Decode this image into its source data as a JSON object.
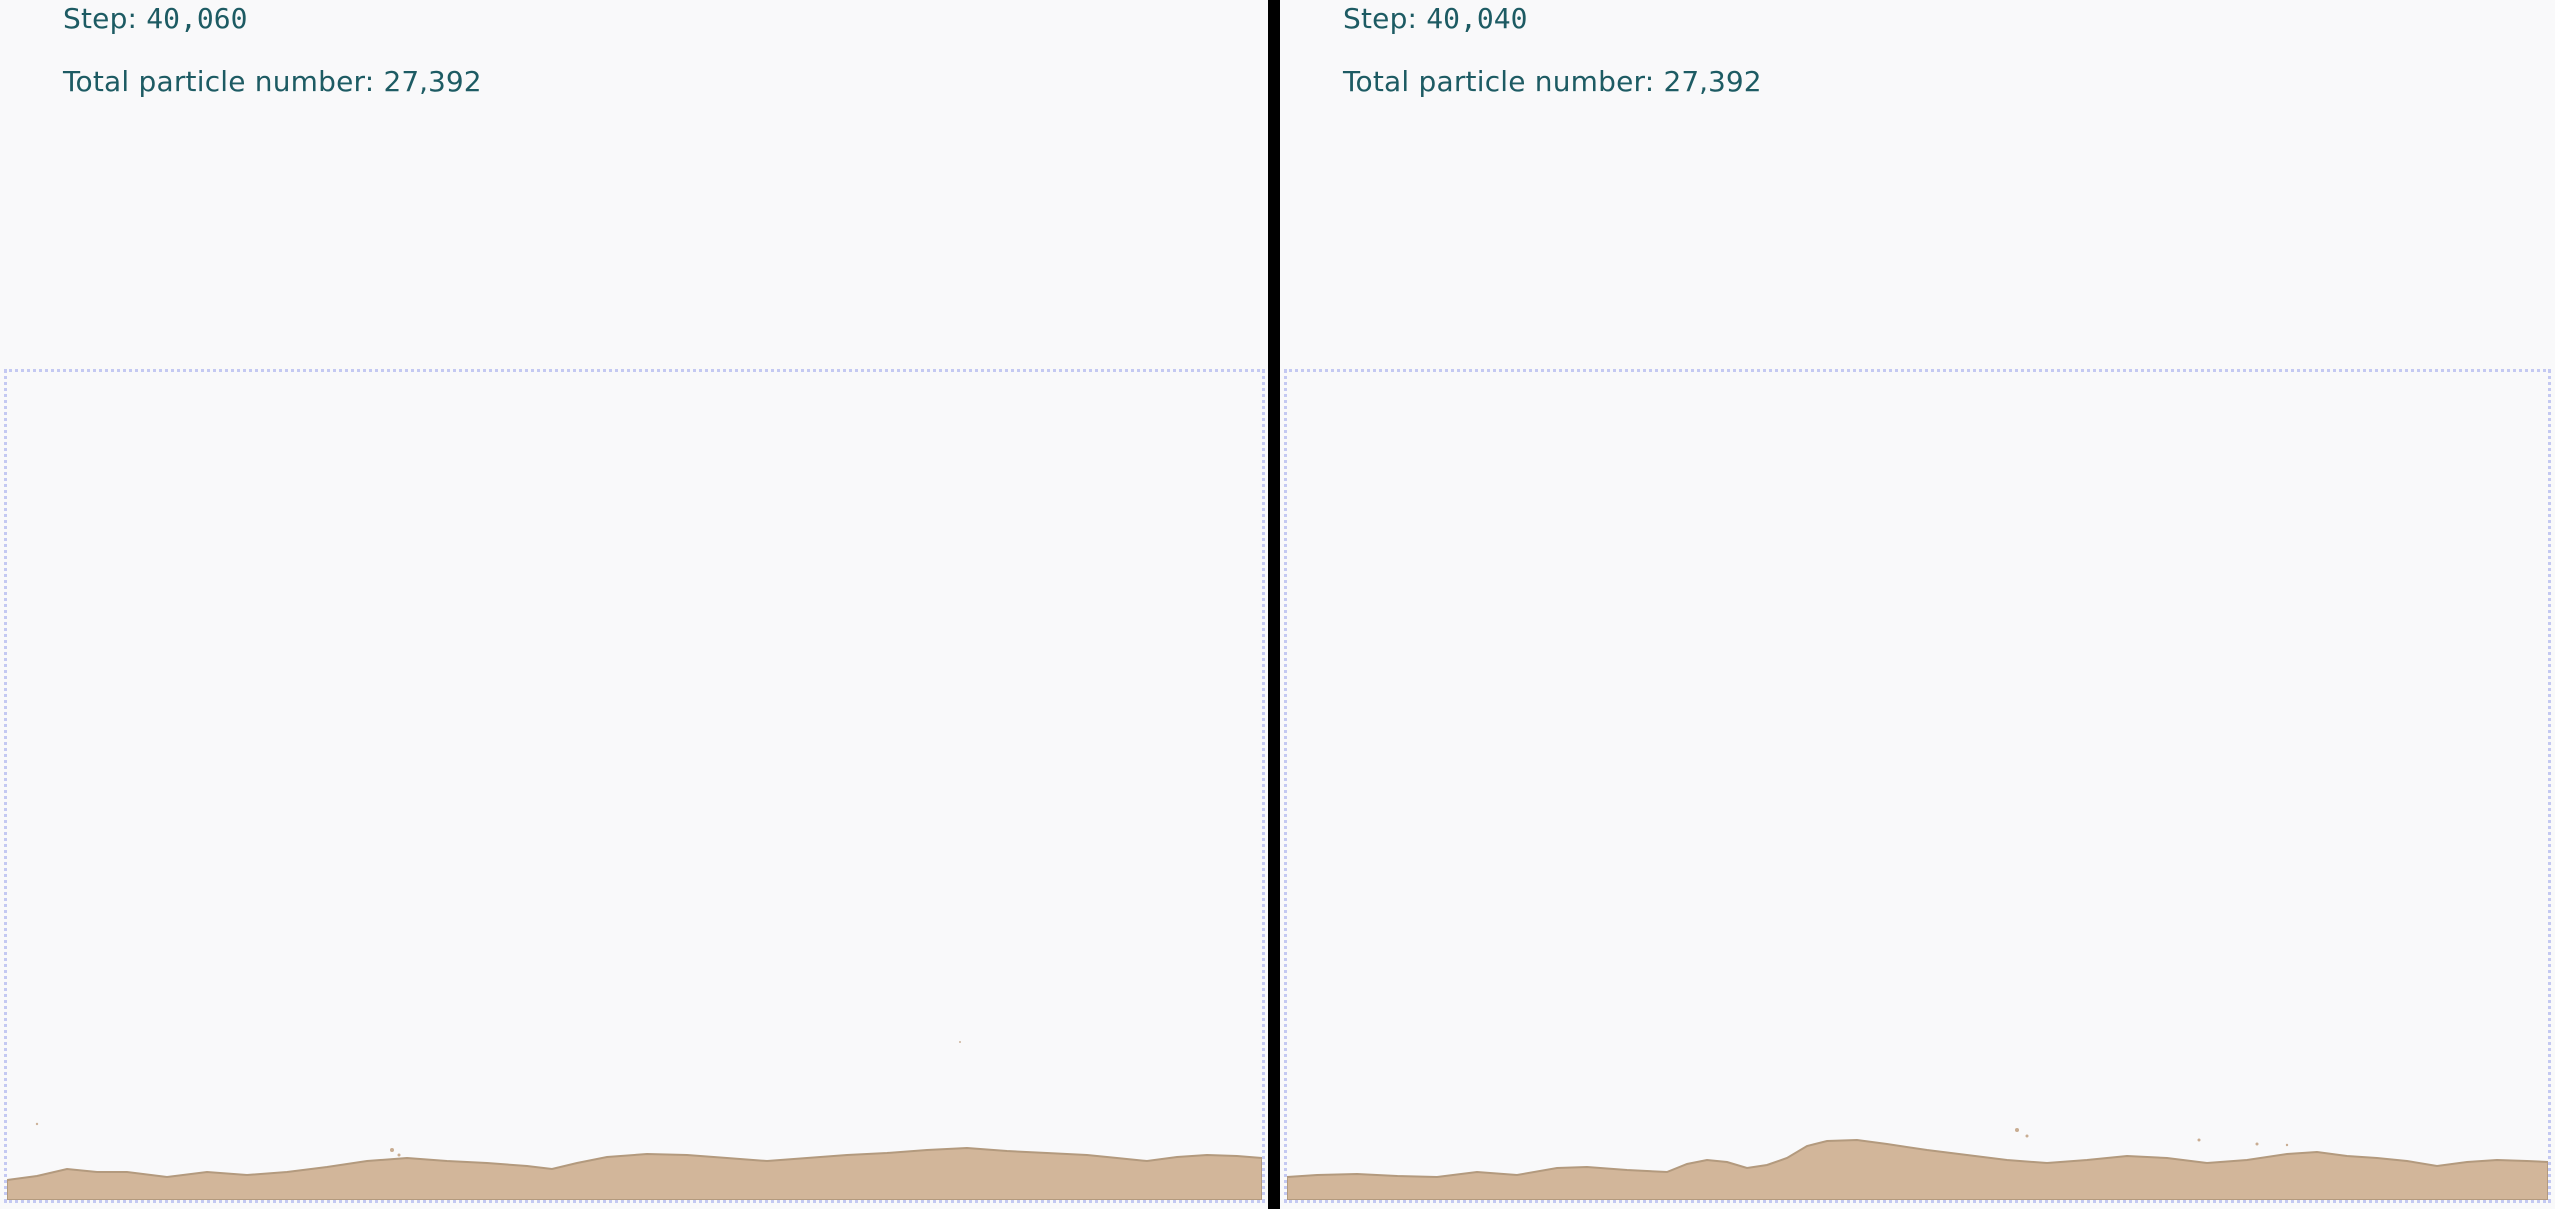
{
  "colors": {
    "background": "#f9f9fa",
    "separator": "#000000",
    "hud_text": "#1d5b63",
    "domain_border": "#c4c9f2",
    "sand_fill": "#d2b69a",
    "sand_edge": "#b39a7e"
  },
  "panels": [
    {
      "hud": {
        "step_label": "Step: ",
        "step_value": "40,060",
        "total_label": "Total particle number: ",
        "total_value": "27,392"
      }
    },
    {
      "hud": {
        "step_label": "Step: ",
        "step_value": "40,040",
        "total_label": "Total particle number: ",
        "total_value": "27,392"
      }
    }
  ]
}
